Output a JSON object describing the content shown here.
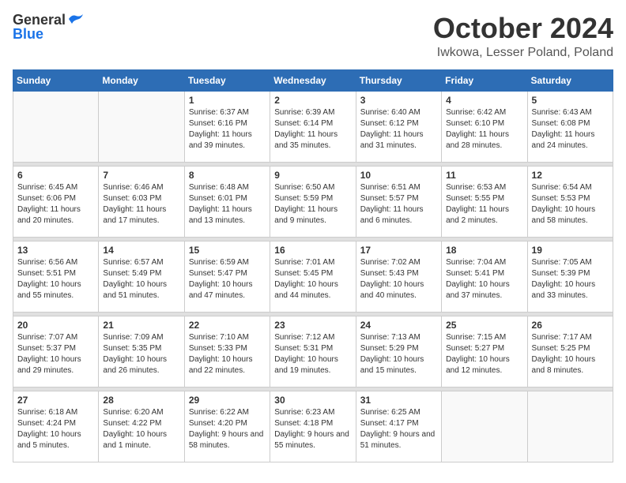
{
  "header": {
    "logo": {
      "general": "General",
      "blue": "Blue",
      "logo_alt": "GeneralBlue logo"
    },
    "title": "October 2024",
    "location": "Iwkowa, Lesser Poland, Poland"
  },
  "days_of_week": [
    "Sunday",
    "Monday",
    "Tuesday",
    "Wednesday",
    "Thursday",
    "Friday",
    "Saturday"
  ],
  "weeks": [
    [
      {
        "day": "",
        "info": ""
      },
      {
        "day": "",
        "info": ""
      },
      {
        "day": "1",
        "info": "Sunrise: 6:37 AM\nSunset: 6:16 PM\nDaylight: 11 hours and 39 minutes."
      },
      {
        "day": "2",
        "info": "Sunrise: 6:39 AM\nSunset: 6:14 PM\nDaylight: 11 hours and 35 minutes."
      },
      {
        "day": "3",
        "info": "Sunrise: 6:40 AM\nSunset: 6:12 PM\nDaylight: 11 hours and 31 minutes."
      },
      {
        "day": "4",
        "info": "Sunrise: 6:42 AM\nSunset: 6:10 PM\nDaylight: 11 hours and 28 minutes."
      },
      {
        "day": "5",
        "info": "Sunrise: 6:43 AM\nSunset: 6:08 PM\nDaylight: 11 hours and 24 minutes."
      }
    ],
    [
      {
        "day": "6",
        "info": "Sunrise: 6:45 AM\nSunset: 6:06 PM\nDaylight: 11 hours and 20 minutes."
      },
      {
        "day": "7",
        "info": "Sunrise: 6:46 AM\nSunset: 6:03 PM\nDaylight: 11 hours and 17 minutes."
      },
      {
        "day": "8",
        "info": "Sunrise: 6:48 AM\nSunset: 6:01 PM\nDaylight: 11 hours and 13 minutes."
      },
      {
        "day": "9",
        "info": "Sunrise: 6:50 AM\nSunset: 5:59 PM\nDaylight: 11 hours and 9 minutes."
      },
      {
        "day": "10",
        "info": "Sunrise: 6:51 AM\nSunset: 5:57 PM\nDaylight: 11 hours and 6 minutes."
      },
      {
        "day": "11",
        "info": "Sunrise: 6:53 AM\nSunset: 5:55 PM\nDaylight: 11 hours and 2 minutes."
      },
      {
        "day": "12",
        "info": "Sunrise: 6:54 AM\nSunset: 5:53 PM\nDaylight: 10 hours and 58 minutes."
      }
    ],
    [
      {
        "day": "13",
        "info": "Sunrise: 6:56 AM\nSunset: 5:51 PM\nDaylight: 10 hours and 55 minutes."
      },
      {
        "day": "14",
        "info": "Sunrise: 6:57 AM\nSunset: 5:49 PM\nDaylight: 10 hours and 51 minutes."
      },
      {
        "day": "15",
        "info": "Sunrise: 6:59 AM\nSunset: 5:47 PM\nDaylight: 10 hours and 47 minutes."
      },
      {
        "day": "16",
        "info": "Sunrise: 7:01 AM\nSunset: 5:45 PM\nDaylight: 10 hours and 44 minutes."
      },
      {
        "day": "17",
        "info": "Sunrise: 7:02 AM\nSunset: 5:43 PM\nDaylight: 10 hours and 40 minutes."
      },
      {
        "day": "18",
        "info": "Sunrise: 7:04 AM\nSunset: 5:41 PM\nDaylight: 10 hours and 37 minutes."
      },
      {
        "day": "19",
        "info": "Sunrise: 7:05 AM\nSunset: 5:39 PM\nDaylight: 10 hours and 33 minutes."
      }
    ],
    [
      {
        "day": "20",
        "info": "Sunrise: 7:07 AM\nSunset: 5:37 PM\nDaylight: 10 hours and 29 minutes."
      },
      {
        "day": "21",
        "info": "Sunrise: 7:09 AM\nSunset: 5:35 PM\nDaylight: 10 hours and 26 minutes."
      },
      {
        "day": "22",
        "info": "Sunrise: 7:10 AM\nSunset: 5:33 PM\nDaylight: 10 hours and 22 minutes."
      },
      {
        "day": "23",
        "info": "Sunrise: 7:12 AM\nSunset: 5:31 PM\nDaylight: 10 hours and 19 minutes."
      },
      {
        "day": "24",
        "info": "Sunrise: 7:13 AM\nSunset: 5:29 PM\nDaylight: 10 hours and 15 minutes."
      },
      {
        "day": "25",
        "info": "Sunrise: 7:15 AM\nSunset: 5:27 PM\nDaylight: 10 hours and 12 minutes."
      },
      {
        "day": "26",
        "info": "Sunrise: 7:17 AM\nSunset: 5:25 PM\nDaylight: 10 hours and 8 minutes."
      }
    ],
    [
      {
        "day": "27",
        "info": "Sunrise: 6:18 AM\nSunset: 4:24 PM\nDaylight: 10 hours and 5 minutes."
      },
      {
        "day": "28",
        "info": "Sunrise: 6:20 AM\nSunset: 4:22 PM\nDaylight: 10 hours and 1 minute."
      },
      {
        "day": "29",
        "info": "Sunrise: 6:22 AM\nSunset: 4:20 PM\nDaylight: 9 hours and 58 minutes."
      },
      {
        "day": "30",
        "info": "Sunrise: 6:23 AM\nSunset: 4:18 PM\nDaylight: 9 hours and 55 minutes."
      },
      {
        "day": "31",
        "info": "Sunrise: 6:25 AM\nSunset: 4:17 PM\nDaylight: 9 hours and 51 minutes."
      },
      {
        "day": "",
        "info": ""
      },
      {
        "day": "",
        "info": ""
      }
    ]
  ]
}
